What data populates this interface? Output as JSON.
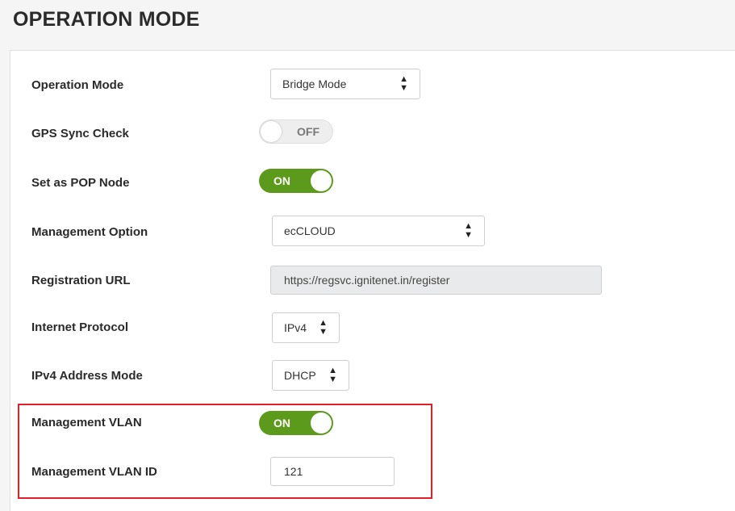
{
  "page": {
    "title": "OPERATION MODE"
  },
  "form": {
    "operation_mode": {
      "label": "Operation Mode",
      "value": "Bridge Mode"
    },
    "gps_sync_check": {
      "label": "GPS Sync Check",
      "state": "OFF"
    },
    "pop_node": {
      "label": "Set as POP Node",
      "state": "ON"
    },
    "management_option": {
      "label": "Management Option",
      "value": "ecCLOUD"
    },
    "registration_url": {
      "label": "Registration URL",
      "value": "https://regsvc.ignitenet.in/register"
    },
    "internet_protocol": {
      "label": "Internet Protocol",
      "value": "IPv4"
    },
    "ipv4_address_mode": {
      "label": "IPv4 Address Mode",
      "value": "DHCP"
    },
    "management_vlan": {
      "label": "Management VLAN",
      "state": "ON"
    },
    "management_vlan_id": {
      "label": "Management VLAN ID",
      "value": "121"
    }
  },
  "icons": {
    "select_arrow": "updown-arrows-icon",
    "toggle_knob": "toggle-knob"
  },
  "colors": {
    "toggle_on": "#5c9a1b",
    "highlight": "#e3202a",
    "readonly_bg": "#e9eaeb"
  }
}
